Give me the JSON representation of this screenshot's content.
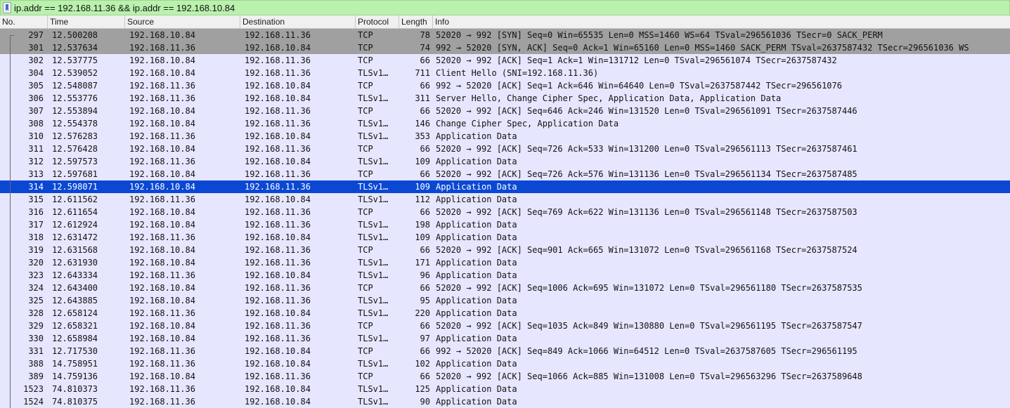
{
  "filter": {
    "icon": "bookmark-icon",
    "text": "ip.addr == 192.168.11.36 && ip.addr == 192.168.10.84"
  },
  "columns": {
    "no": "No.",
    "time": "Time",
    "source": "Source",
    "destination": "Destination",
    "protocol": "Protocol",
    "length": "Length",
    "info": "Info"
  },
  "colors": {
    "filter_bg": "#b9f1ad",
    "row_default": "#e7e6ff",
    "row_syn": "#a0a0a0",
    "row_selected": "#0a48d4"
  },
  "packets": [
    {
      "no": "297",
      "time": "12.500208",
      "src": "192.168.10.84",
      "dst": "192.168.11.36",
      "proto": "TCP",
      "len": "78",
      "info": "52020 → 992 [SYN] Seq=0 Win=65535 Len=0 MSS=1460 WS=64 TSval=296561036 TSecr=0 SACK_PERM",
      "style": "syn"
    },
    {
      "no": "301",
      "time": "12.537634",
      "src": "192.168.11.36",
      "dst": "192.168.10.84",
      "proto": "TCP",
      "len": "74",
      "info": "992 → 52020 [SYN, ACK] Seq=0 Ack=1 Win=65160 Len=0 MSS=1460 SACK_PERM TSval=2637587432 TSecr=296561036 WS",
      "style": "syn"
    },
    {
      "no": "302",
      "time": "12.537775",
      "src": "192.168.10.84",
      "dst": "192.168.11.36",
      "proto": "TCP",
      "len": "66",
      "info": "52020 → 992 [ACK] Seq=1 Ack=1 Win=131712 Len=0 TSval=296561074 TSecr=2637587432",
      "style": "normal"
    },
    {
      "no": "304",
      "time": "12.539052",
      "src": "192.168.10.84",
      "dst": "192.168.11.36",
      "proto": "TLSv1…",
      "len": "711",
      "info": "Client Hello (SNI=192.168.11.36)",
      "style": "normal"
    },
    {
      "no": "305",
      "time": "12.548087",
      "src": "192.168.11.36",
      "dst": "192.168.10.84",
      "proto": "TCP",
      "len": "66",
      "info": "992 → 52020 [ACK] Seq=1 Ack=646 Win=64640 Len=0 TSval=2637587442 TSecr=296561076",
      "style": "normal"
    },
    {
      "no": "306",
      "time": "12.553776",
      "src": "192.168.11.36",
      "dst": "192.168.10.84",
      "proto": "TLSv1…",
      "len": "311",
      "info": "Server Hello, Change Cipher Spec, Application Data, Application Data",
      "style": "normal"
    },
    {
      "no": "307",
      "time": "12.553894",
      "src": "192.168.10.84",
      "dst": "192.168.11.36",
      "proto": "TCP",
      "len": "66",
      "info": "52020 → 992 [ACK] Seq=646 Ack=246 Win=131520 Len=0 TSval=296561091 TSecr=2637587446",
      "style": "normal"
    },
    {
      "no": "308",
      "time": "12.554378",
      "src": "192.168.10.84",
      "dst": "192.168.11.36",
      "proto": "TLSv1…",
      "len": "146",
      "info": "Change Cipher Spec, Application Data",
      "style": "normal"
    },
    {
      "no": "310",
      "time": "12.576283",
      "src": "192.168.11.36",
      "dst": "192.168.10.84",
      "proto": "TLSv1…",
      "len": "353",
      "info": "Application Data",
      "style": "normal"
    },
    {
      "no": "311",
      "time": "12.576428",
      "src": "192.168.10.84",
      "dst": "192.168.11.36",
      "proto": "TCP",
      "len": "66",
      "info": "52020 → 992 [ACK] Seq=726 Ack=533 Win=131200 Len=0 TSval=296561113 TSecr=2637587461",
      "style": "normal"
    },
    {
      "no": "312",
      "time": "12.597573",
      "src": "192.168.11.36",
      "dst": "192.168.10.84",
      "proto": "TLSv1…",
      "len": "109",
      "info": "Application Data",
      "style": "normal"
    },
    {
      "no": "313",
      "time": "12.597681",
      "src": "192.168.10.84",
      "dst": "192.168.11.36",
      "proto": "TCP",
      "len": "66",
      "info": "52020 → 992 [ACK] Seq=726 Ack=576 Win=131136 Len=0 TSval=296561134 TSecr=2637587485",
      "style": "normal"
    },
    {
      "no": "314",
      "time": "12.598071",
      "src": "192.168.10.84",
      "dst": "192.168.11.36",
      "proto": "TLSv1…",
      "len": "109",
      "info": "Application Data",
      "style": "sel"
    },
    {
      "no": "315",
      "time": "12.611562",
      "src": "192.168.11.36",
      "dst": "192.168.10.84",
      "proto": "TLSv1…",
      "len": "112",
      "info": "Application Data",
      "style": "normal"
    },
    {
      "no": "316",
      "time": "12.611654",
      "src": "192.168.10.84",
      "dst": "192.168.11.36",
      "proto": "TCP",
      "len": "66",
      "info": "52020 → 992 [ACK] Seq=769 Ack=622 Win=131136 Len=0 TSval=296561148 TSecr=2637587503",
      "style": "normal"
    },
    {
      "no": "317",
      "time": "12.612924",
      "src": "192.168.10.84",
      "dst": "192.168.11.36",
      "proto": "TLSv1…",
      "len": "198",
      "info": "Application Data",
      "style": "normal"
    },
    {
      "no": "318",
      "time": "12.631472",
      "src": "192.168.11.36",
      "dst": "192.168.10.84",
      "proto": "TLSv1…",
      "len": "109",
      "info": "Application Data",
      "style": "normal"
    },
    {
      "no": "319",
      "time": "12.631568",
      "src": "192.168.10.84",
      "dst": "192.168.11.36",
      "proto": "TCP",
      "len": "66",
      "info": "52020 → 992 [ACK] Seq=901 Ack=665 Win=131072 Len=0 TSval=296561168 TSecr=2637587524",
      "style": "normal"
    },
    {
      "no": "320",
      "time": "12.631930",
      "src": "192.168.10.84",
      "dst": "192.168.11.36",
      "proto": "TLSv1…",
      "len": "171",
      "info": "Application Data",
      "style": "normal"
    },
    {
      "no": "323",
      "time": "12.643334",
      "src": "192.168.11.36",
      "dst": "192.168.10.84",
      "proto": "TLSv1…",
      "len": "96",
      "info": "Application Data",
      "style": "normal"
    },
    {
      "no": "324",
      "time": "12.643400",
      "src": "192.168.10.84",
      "dst": "192.168.11.36",
      "proto": "TCP",
      "len": "66",
      "info": "52020 → 992 [ACK] Seq=1006 Ack=695 Win=131072 Len=0 TSval=296561180 TSecr=2637587535",
      "style": "normal"
    },
    {
      "no": "325",
      "time": "12.643885",
      "src": "192.168.10.84",
      "dst": "192.168.11.36",
      "proto": "TLSv1…",
      "len": "95",
      "info": "Application Data",
      "style": "normal"
    },
    {
      "no": "328",
      "time": "12.658124",
      "src": "192.168.11.36",
      "dst": "192.168.10.84",
      "proto": "TLSv1…",
      "len": "220",
      "info": "Application Data",
      "style": "normal"
    },
    {
      "no": "329",
      "time": "12.658321",
      "src": "192.168.10.84",
      "dst": "192.168.11.36",
      "proto": "TCP",
      "len": "66",
      "info": "52020 → 992 [ACK] Seq=1035 Ack=849 Win=130880 Len=0 TSval=296561195 TSecr=2637587547",
      "style": "normal"
    },
    {
      "no": "330",
      "time": "12.658984",
      "src": "192.168.10.84",
      "dst": "192.168.11.36",
      "proto": "TLSv1…",
      "len": "97",
      "info": "Application Data",
      "style": "normal"
    },
    {
      "no": "331",
      "time": "12.717530",
      "src": "192.168.11.36",
      "dst": "192.168.10.84",
      "proto": "TCP",
      "len": "66",
      "info": "992 → 52020 [ACK] Seq=849 Ack=1066 Win=64512 Len=0 TSval=2637587605 TSecr=296561195",
      "style": "normal"
    },
    {
      "no": "388",
      "time": "14.758951",
      "src": "192.168.11.36",
      "dst": "192.168.10.84",
      "proto": "TLSv1…",
      "len": "102",
      "info": "Application Data",
      "style": "normal"
    },
    {
      "no": "389",
      "time": "14.759136",
      "src": "192.168.10.84",
      "dst": "192.168.11.36",
      "proto": "TCP",
      "len": "66",
      "info": "52020 → 992 [ACK] Seq=1066 Ack=885 Win=131008 Len=0 TSval=296563296 TSecr=2637589648",
      "style": "normal"
    },
    {
      "no": "1523",
      "time": "74.810373",
      "src": "192.168.11.36",
      "dst": "192.168.10.84",
      "proto": "TLSv1…",
      "len": "125",
      "info": "Application Data",
      "style": "normal"
    },
    {
      "no": "1524",
      "time": "74.810375",
      "src": "192.168.11.36",
      "dst": "192.168.10.84",
      "proto": "TLSv1…",
      "len": "90",
      "info": "Application Data",
      "style": "normal"
    }
  ]
}
